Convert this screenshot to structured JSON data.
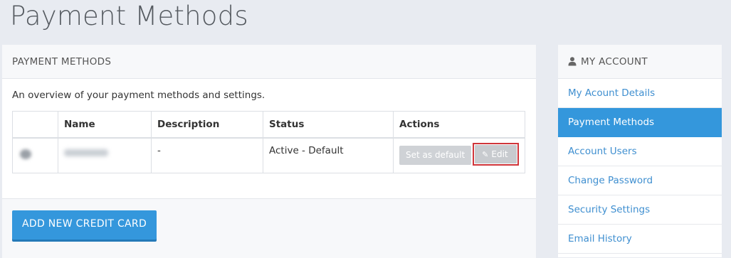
{
  "page": {
    "title": "Payment Methods"
  },
  "panel": {
    "header": "PAYMENT METHODS",
    "description": "An overview of your payment methods and settings.",
    "table": {
      "headers": [
        "",
        "Name",
        "Description",
        "Status",
        "Actions"
      ],
      "rows": [
        {
          "description": "-",
          "status": "Active - Default",
          "set_default_label": "Set as default",
          "edit_label": "Edit"
        }
      ]
    },
    "add_button": "ADD NEW CREDIT CARD"
  },
  "sidebar": {
    "header": "MY ACCOUNT",
    "items": [
      {
        "label": "My Acount Details",
        "active": false
      },
      {
        "label": "Payment Methods",
        "active": true
      },
      {
        "label": "Account Users",
        "active": false
      },
      {
        "label": "Change Password",
        "active": false
      },
      {
        "label": "Security Settings",
        "active": false
      },
      {
        "label": "Email History",
        "active": false
      }
    ]
  },
  "colors": {
    "accent": "#3497dc",
    "highlight_frame": "#d0353a",
    "background": "#e8ebf1"
  },
  "icons": {
    "sidebar_header": "user-icon",
    "edit": "pencil-icon"
  }
}
